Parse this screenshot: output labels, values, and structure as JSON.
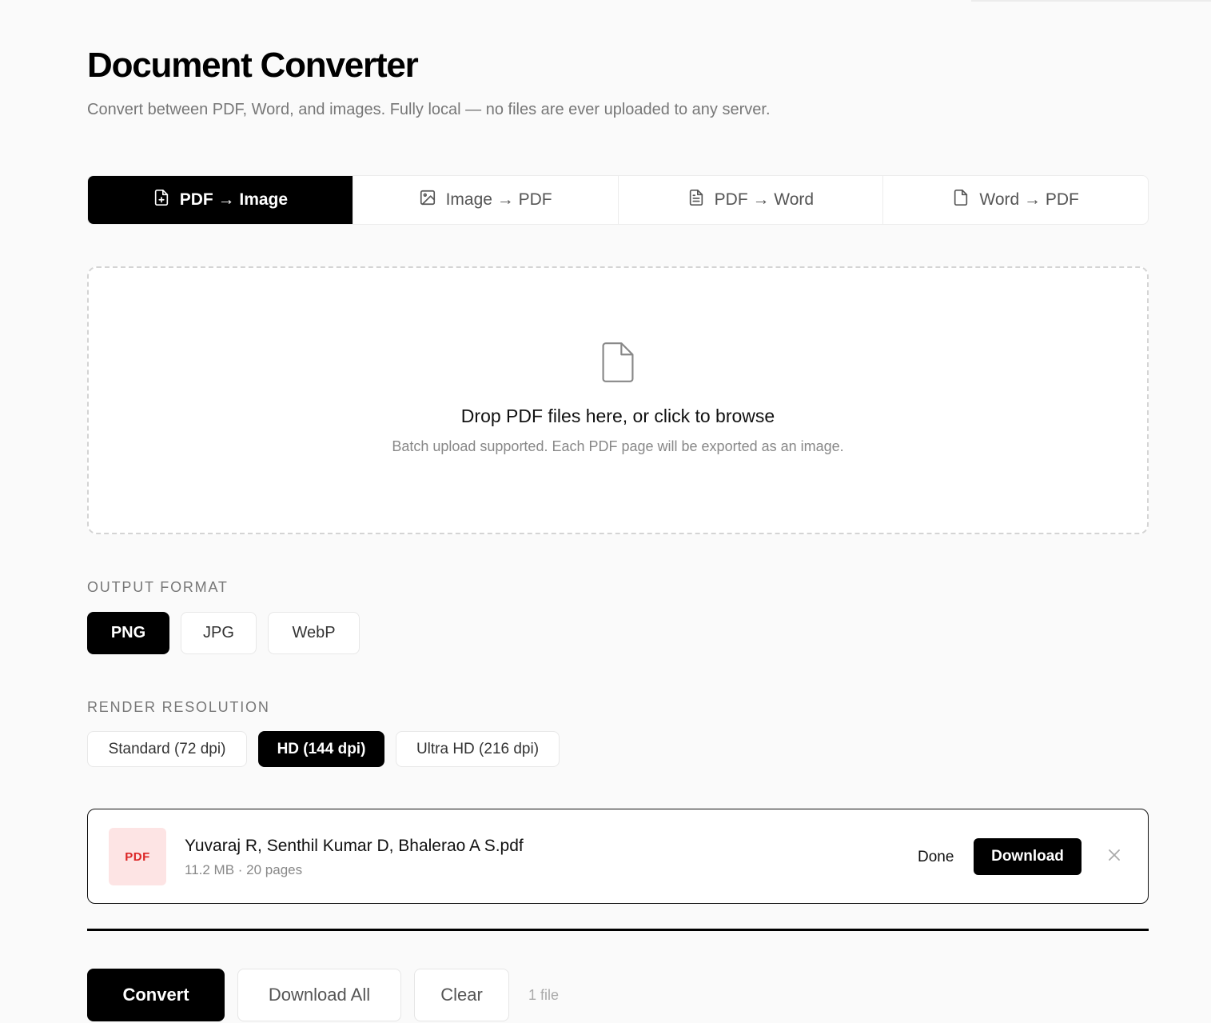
{
  "header": {
    "title": "Document Converter",
    "subtitle": "Convert between PDF, Word, and images. Fully local — no files are ever uploaded to any server."
  },
  "tabs": [
    {
      "label": "PDF → Image",
      "icon": "file-plus-icon",
      "active": true
    },
    {
      "label": "Image → PDF",
      "icon": "image-icon",
      "active": false
    },
    {
      "label": "PDF → Word",
      "icon": "file-text-icon",
      "active": false
    },
    {
      "label": "Word → PDF",
      "icon": "file-icon",
      "active": false
    }
  ],
  "dropzone": {
    "title": "Drop PDF files here, or click to browse",
    "subtitle": "Batch upload supported. Each PDF page will be exported as an image.",
    "icon": "file-icon"
  },
  "output_format": {
    "label": "OUTPUT FORMAT",
    "options": [
      "PNG",
      "JPG",
      "WebP"
    ],
    "selected": "PNG"
  },
  "render_resolution": {
    "label": "RENDER RESOLUTION",
    "options": [
      "Standard (72 dpi)",
      "HD (144 dpi)",
      "Ultra HD (216 dpi)"
    ],
    "selected": "HD (144 dpi)"
  },
  "file": {
    "badge": "PDF",
    "name": "Yuvaraj R, Senthil Kumar D, Bhalerao A S.pdf",
    "meta": "11.2 MB · 20 pages",
    "status": "Done",
    "download_label": "Download",
    "progress": 1.0
  },
  "actions": {
    "convert_label": "Convert",
    "download_all_label": "Download All",
    "clear_label": "Clear",
    "file_count": "1 file"
  },
  "colors": {
    "accent": "#000000",
    "background": "#fafafa",
    "pdf_badge_bg": "#fde4e4",
    "pdf_badge_text": "#dc2626"
  }
}
